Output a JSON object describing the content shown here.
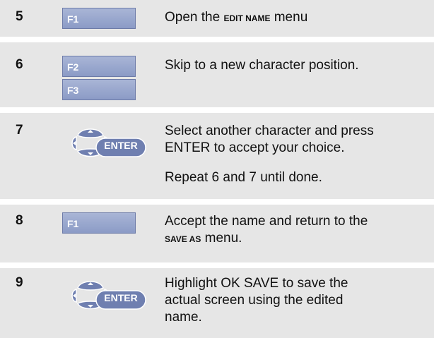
{
  "steps": [
    {
      "number": "5",
      "keys": [
        "F1"
      ],
      "text_before": "Open the ",
      "menu": "EDIT NAME",
      "text_after": " menu"
    },
    {
      "number": "6",
      "keys": [
        "F2",
        "F3"
      ],
      "text": "Skip to a new character position."
    },
    {
      "number": "7",
      "keypad": {
        "enter_label": "ENTER"
      },
      "line1": "Select another character and press",
      "line2": "ENTER to accept your choice.",
      "extra": "Repeat 6 and 7 until done."
    },
    {
      "number": "8",
      "keys": [
        "F1"
      ],
      "line1": "Accept the name and return to the",
      "menu": "SAVE AS",
      "text_after": " menu."
    },
    {
      "number": "9",
      "keypad": {
        "enter_label": "ENTER"
      },
      "line1": "Highlight OK SAVE to save the",
      "line2": "actual screen using the edited",
      "line3": "name."
    }
  ],
  "colors": {
    "row_bg": "#e6e6e6",
    "key_blue": "#8b9bc6",
    "keypad_blue": "#6f7fb0"
  },
  "icons": [
    "arrow-keypad-icon"
  ]
}
